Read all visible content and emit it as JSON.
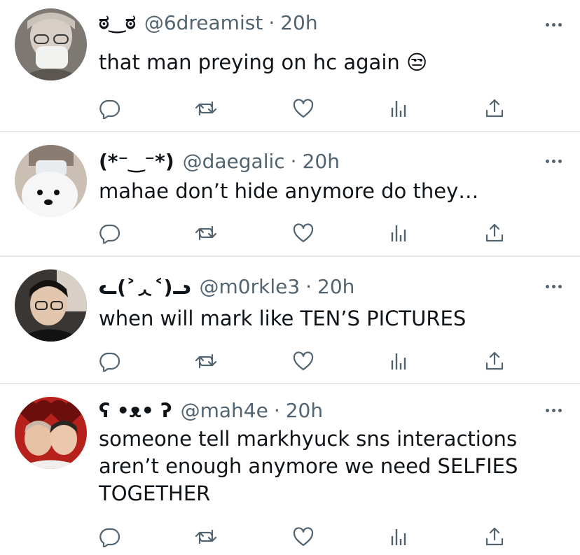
{
  "tweets": [
    {
      "display_name": "ಠ‿ಠ",
      "handle": "@6dreamist",
      "separator": "·",
      "time": "20h",
      "text": "that man preying on hc again 😒"
    },
    {
      "display_name": "(*⁻‿⁻*)",
      "handle": "@daegalic",
      "separator": "·",
      "time": "20h",
      "text": "mahae don’t hide anymore do they…"
    },
    {
      "display_name": "ᓚ(˃ᆺ˂)ᓗ",
      "handle": "@m0rkle3",
      "separator": "·",
      "time": "20h",
      "text": "when will mark like TEN’S PICTURES"
    },
    {
      "display_name": "ʕ •ᴥ• ʔ",
      "handle": "@mah4e",
      "separator": "·",
      "time": "20h",
      "text": "someone tell markhyuck sns interactions aren’t enough anymore we need SELFIES TOGETHER"
    }
  ],
  "icons": {
    "reply": "reply-icon",
    "retweet": "retweet-icon",
    "like": "like-icon",
    "analytics": "analytics-icon",
    "share": "share-icon",
    "more": "more-icon"
  },
  "colors": {
    "text": "#0f1419",
    "secondary": "#536471",
    "divider": "#e6e9eb",
    "background": "#ffffff"
  }
}
